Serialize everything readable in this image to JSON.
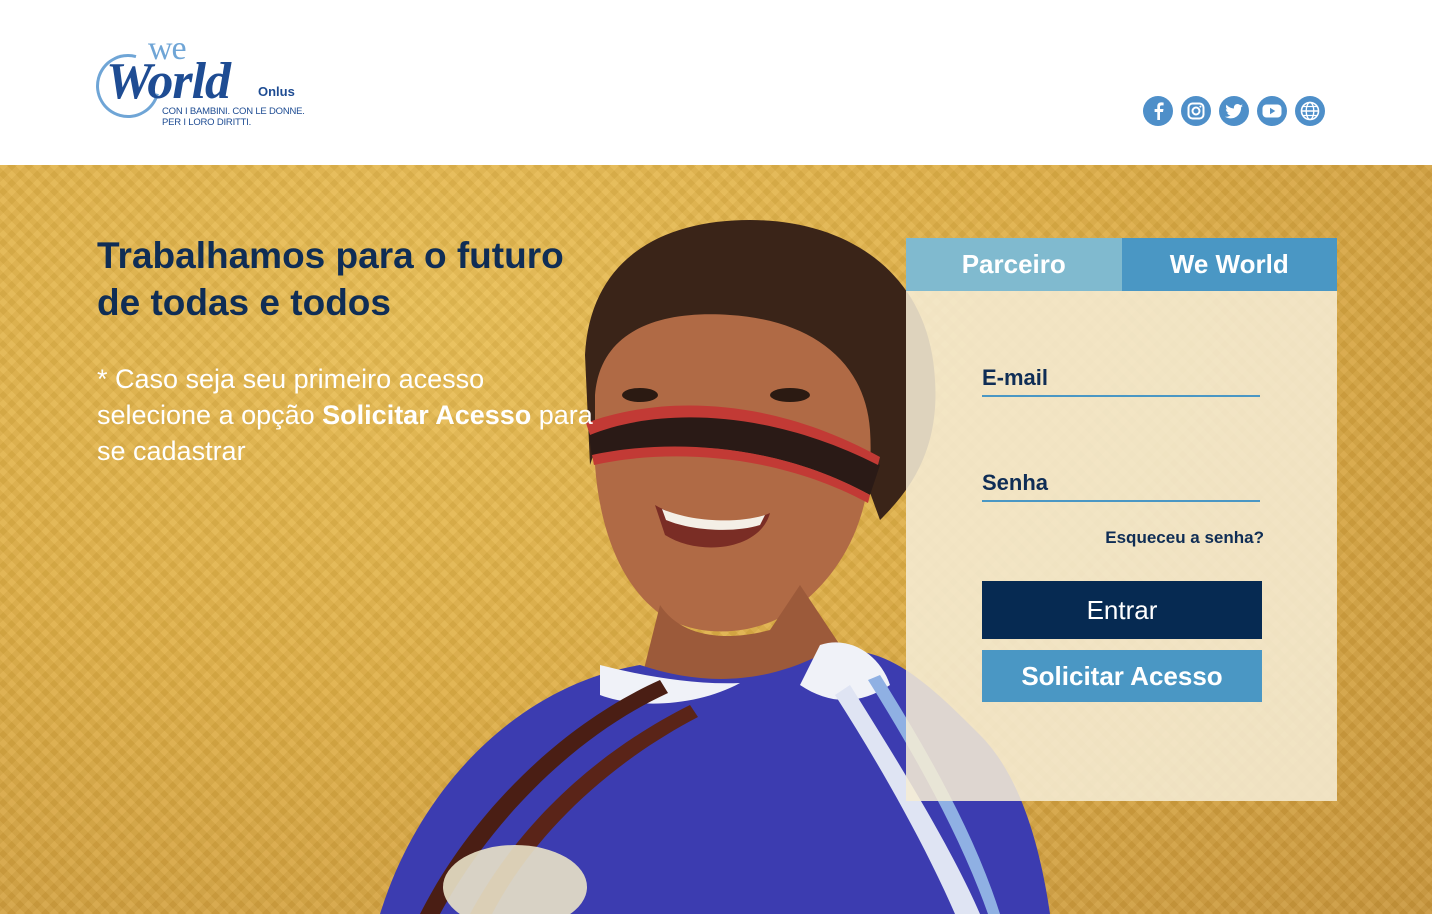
{
  "brand": {
    "logo_we": "we",
    "logo_world": "World",
    "logo_onlus": "Onlus",
    "tagline_line1": "CON I BAMBINI. CON LE DONNE.",
    "tagline_line2": "PER I LORO DIRITTI."
  },
  "social": [
    {
      "name": "facebook-icon",
      "glyph": "f"
    },
    {
      "name": "instagram-icon",
      "glyph": "◎"
    },
    {
      "name": "twitter-icon",
      "glyph": "t"
    },
    {
      "name": "youtube-icon",
      "glyph": "▶"
    },
    {
      "name": "globe-icon",
      "glyph": "⊕"
    }
  ],
  "hero": {
    "headline": "Trabalhamos para o futuro de todas e todos",
    "notice_prefix": "* Caso seja seu primeiro acesso selecione a opção ",
    "notice_bold": "Solicitar Acesso",
    "notice_suffix": " para se cadastrar"
  },
  "login": {
    "tabs": [
      {
        "label": "Parceiro"
      },
      {
        "label": "We World"
      }
    ],
    "email_label": "E-mail",
    "password_label": "Senha",
    "forgot_label": "Esqueceu a senha?",
    "enter_label": "Entrar",
    "request_label": "Solicitar Acesso"
  },
  "colors": {
    "navy": "#0f2d55",
    "accent": "#4a97c4",
    "accent_light": "#80bacf",
    "button_dark": "#062a52",
    "background_gold": "#dfae45"
  }
}
